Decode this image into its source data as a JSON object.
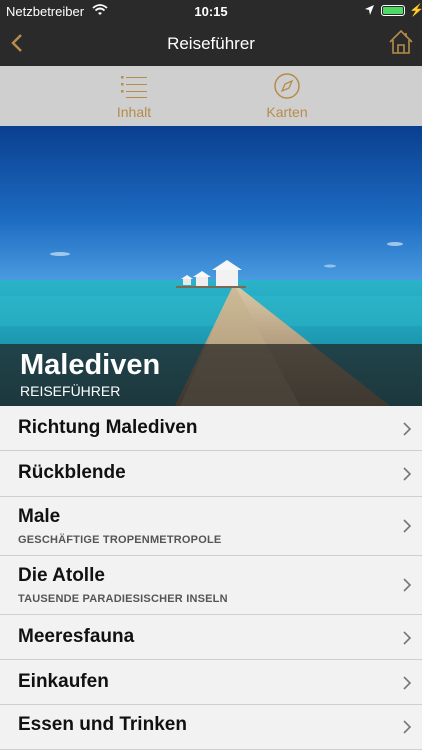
{
  "status_bar": {
    "carrier": "Netzbetreiber",
    "time": "10:15",
    "battery_color": "#4cd964"
  },
  "nav": {
    "title": "Reiseführer",
    "accent": "#b58c4a"
  },
  "tabs": [
    {
      "label": "Inhalt",
      "icon": "list-icon"
    },
    {
      "label": "Karten",
      "icon": "compass-icon"
    }
  ],
  "hero": {
    "title": "Malediven",
    "subtitle": "REISEFÜHRER"
  },
  "list": [
    {
      "title": "Richtung Malediven",
      "subtitle": ""
    },
    {
      "title": "Rückblende",
      "subtitle": ""
    },
    {
      "title": "Male",
      "subtitle": "GESCHÄFTIGE TROPENMETROPOLE"
    },
    {
      "title": "Die Atolle",
      "subtitle": "TAUSENDE PARADIESISCHER INSELN"
    },
    {
      "title": "Meeresfauna",
      "subtitle": ""
    },
    {
      "title": "Einkaufen",
      "subtitle": ""
    },
    {
      "title": "Essen und Trinken",
      "subtitle": ""
    }
  ]
}
